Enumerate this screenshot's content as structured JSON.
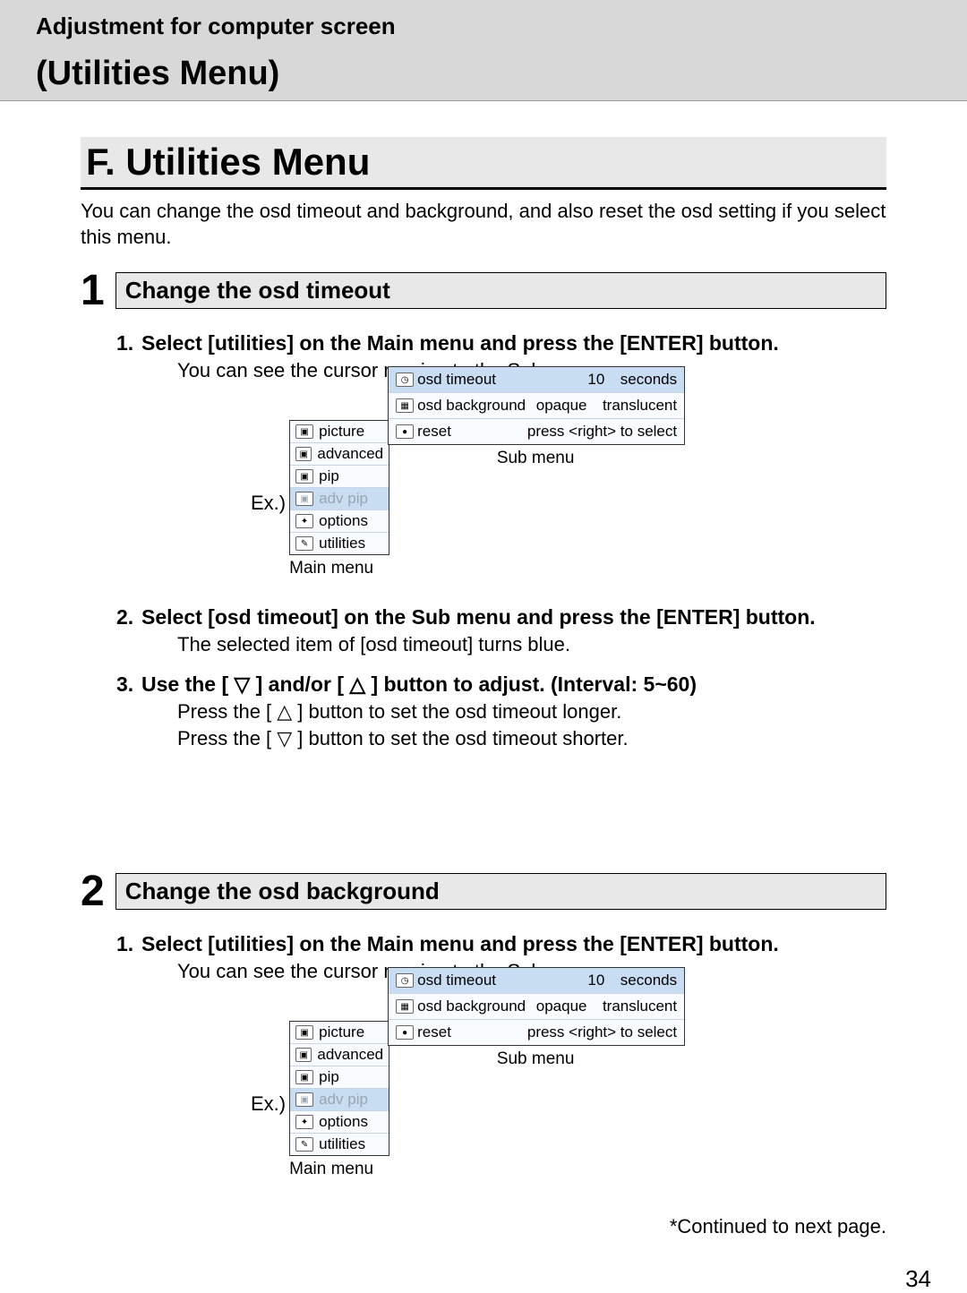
{
  "header": {
    "title": "Adjustment for computer screen",
    "subtitle": "(Utilities Menu)"
  },
  "section": "F. Utilities Menu",
  "intro": "You can change the osd timeout and background, and also reset the osd setting if you select this menu.",
  "block1": {
    "num": "1",
    "title": "Change the osd timeout",
    "step1_num": "1.",
    "step1_a": "Select [",
    "step1_code": "utilities",
    "step1_b": "] on the Main menu and press the [ENTER] button.",
    "step1_sub": "You can see the cursor moving to the Sub menu.",
    "step2_num": "2.",
    "step2_a": "Select [",
    "step2_code": "osd timeout",
    "step2_b": "] on the Sub menu and press the [ENTER] button.",
    "step2_sub_a": "The selected item of [",
    "step2_sub_code": "osd timeout",
    "step2_sub_b": "] turns blue.",
    "step3_num": "3.",
    "step3_text": "Use the [ ▽ ] and/or [ △ ] button to adjust. (Interval: 5~60)",
    "step3_sub1": "Press the [ △ ] button to set the osd timeout longer.",
    "step3_sub2": "Press the [ ▽ ] button to set the osd timeout shorter."
  },
  "block2": {
    "num": "2",
    "title": "Change the osd background",
    "step1_num": "1.",
    "step1_a": "Select [",
    "step1_code": "utilities",
    "step1_b": "] on the Main menu and press the [ENTER] button.",
    "step1_sub": "You can see the cursor moving to the Sub menu."
  },
  "exLabel": "Ex.)",
  "mainMenu": {
    "label": "Main menu",
    "items": [
      {
        "label": "picture",
        "dim": false,
        "sel": false
      },
      {
        "label": "advanced",
        "dim": false,
        "sel": false
      },
      {
        "label": "pip",
        "dim": false,
        "sel": false
      },
      {
        "label": "adv pip",
        "dim": true,
        "sel": true
      },
      {
        "label": "options",
        "dim": false,
        "sel": false
      },
      {
        "label": "utilities",
        "dim": false,
        "sel": false
      }
    ]
  },
  "subMenu": {
    "label": "Sub menu",
    "rows": [
      {
        "label": "osd timeout",
        "val1": "10",
        "val2": "seconds",
        "sel": true
      },
      {
        "label": "osd background",
        "val1": "opaque",
        "val2": "translucent",
        "sel": false
      },
      {
        "label": "reset",
        "val1": "",
        "val2": "press <right> to select",
        "sel": false
      }
    ]
  },
  "continued": "*Continued to next page.",
  "pageNum": "34"
}
